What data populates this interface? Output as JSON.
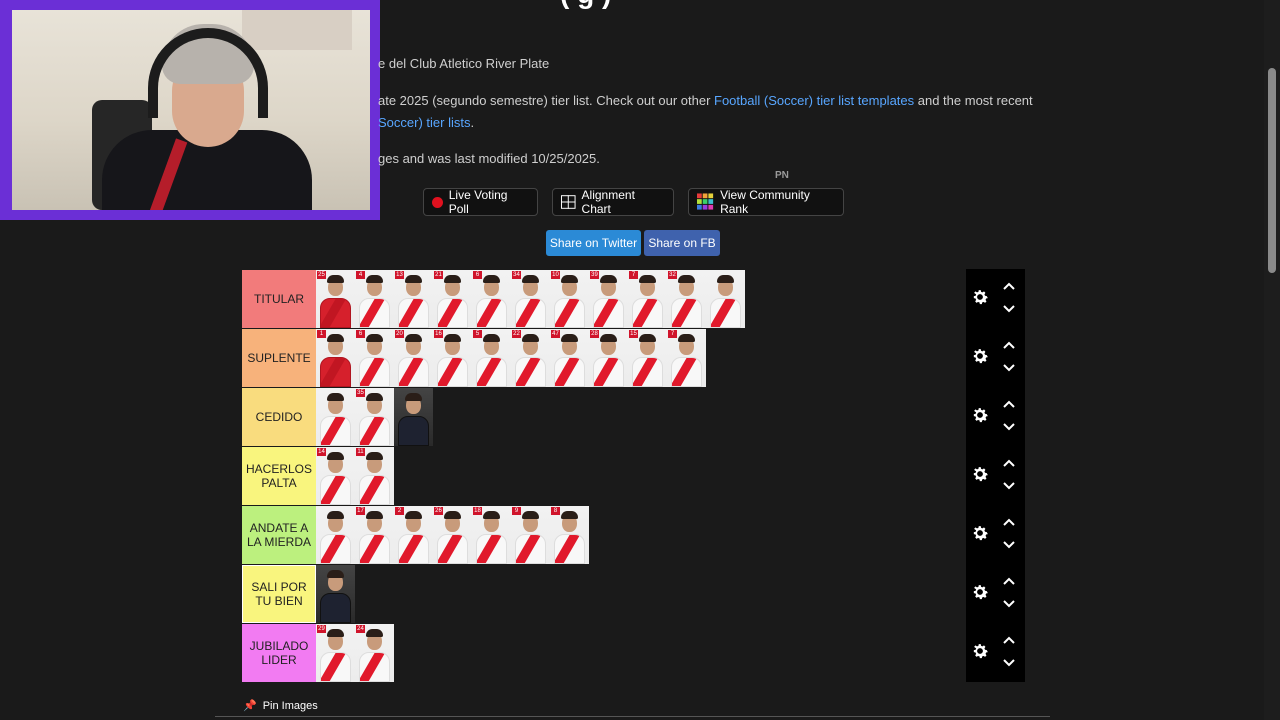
{
  "page": {
    "title_fragment": "(     g              )",
    "desc_line1": "e del Club Atletico River Plate",
    "desc_line2_pre": "ate 2025 (segundo semestre) tier list. Check out our other ",
    "desc_line2_link": "Football (Soccer) tier list templates",
    "desc_line2_post": " and the most recent",
    "desc_line3_link": "Soccer) tier lists",
    "desc_line3_post": ".",
    "desc_line4": "ges and was last modified 10/25/2025.",
    "pn_label": "PN"
  },
  "actions": {
    "live_voting": "Live Voting Poll",
    "alignment_chart": "Alignment Chart",
    "community_rank": "View Community Rank",
    "share_twitter": "Share on Twitter",
    "share_fb": "Share on FB",
    "pin_images": "Pin Images"
  },
  "colors": {
    "twitter": "#2b8ad6",
    "fb": "#3f62ad",
    "live_dot": "#e0111f"
  },
  "tiers": [
    {
      "label": "TITULAR",
      "color": "#f27b7b",
      "players": [
        {
          "n": "25",
          "gk": true
        },
        {
          "n": "4"
        },
        {
          "n": "13"
        },
        {
          "n": "21"
        },
        {
          "n": "6"
        },
        {
          "n": "34"
        },
        {
          "n": "10"
        },
        {
          "n": "39"
        },
        {
          "n": "7"
        },
        {
          "n": "32"
        },
        {
          "n": ""
        }
      ]
    },
    {
      "label": "SUPLENTE",
      "color": "#f7b27b",
      "players": [
        {
          "n": "1",
          "gk": true
        },
        {
          "n": "6"
        },
        {
          "n": "20"
        },
        {
          "n": "16"
        },
        {
          "n": "5"
        },
        {
          "n": "22"
        },
        {
          "n": "47"
        },
        {
          "n": "28"
        },
        {
          "n": "15"
        },
        {
          "n": "7"
        }
      ]
    },
    {
      "label": "CEDIDO",
      "color": "#f9dc7e",
      "players": [
        {
          "n": ""
        },
        {
          "n": "35"
        },
        {
          "n": "",
          "coach": true
        }
      ]
    },
    {
      "label": "HACERLOS PALTA",
      "color": "#f9f57e",
      "players": [
        {
          "n": "14"
        },
        {
          "n": "11"
        }
      ]
    },
    {
      "label": "ANDATE A LA MIERDA",
      "color": "#bcf07e",
      "players": [
        {
          "n": ""
        },
        {
          "n": "17"
        },
        {
          "n": "2"
        },
        {
          "n": "26"
        },
        {
          "n": "18"
        },
        {
          "n": "9"
        },
        {
          "n": "8"
        }
      ]
    },
    {
      "label": "SALI POR TU BIEN",
      "color": "#f9f57e",
      "players": [
        {
          "n": "",
          "coach": true
        }
      ]
    },
    {
      "label": "JUBILADO LIDER",
      "color": "#f27bf2",
      "players": [
        {
          "n": "29"
        },
        {
          "n": "24"
        }
      ]
    }
  ]
}
